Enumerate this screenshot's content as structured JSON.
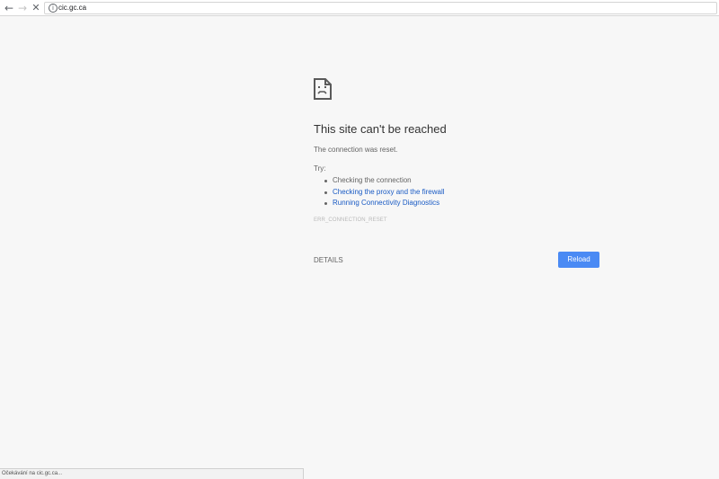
{
  "browser": {
    "back_icon": "←",
    "forward_icon": "→",
    "stop_icon": "✕",
    "info_icon": "i",
    "url": "cic.gc.ca"
  },
  "error_page": {
    "icon": "sad-document-icon",
    "title": "This site can't be reached",
    "subtitle": "The connection was reset.",
    "try_label": "Try:",
    "suggestions": [
      {
        "text": "Checking the connection",
        "link": false
      },
      {
        "text": "Checking the proxy and the firewall",
        "link": true
      },
      {
        "text": "Running Connectivity Diagnostics",
        "link": true
      }
    ],
    "error_code": "ERR_CONNECTION_RESET",
    "details_label": "DETAILS",
    "reload_label": "Reload"
  },
  "status_bar": {
    "text": "Očekávání na cic.gc.ca..."
  },
  "colors": {
    "background": "#f7f7f7",
    "link": "#1a5bc4",
    "reload_button": "#4a8af4"
  }
}
